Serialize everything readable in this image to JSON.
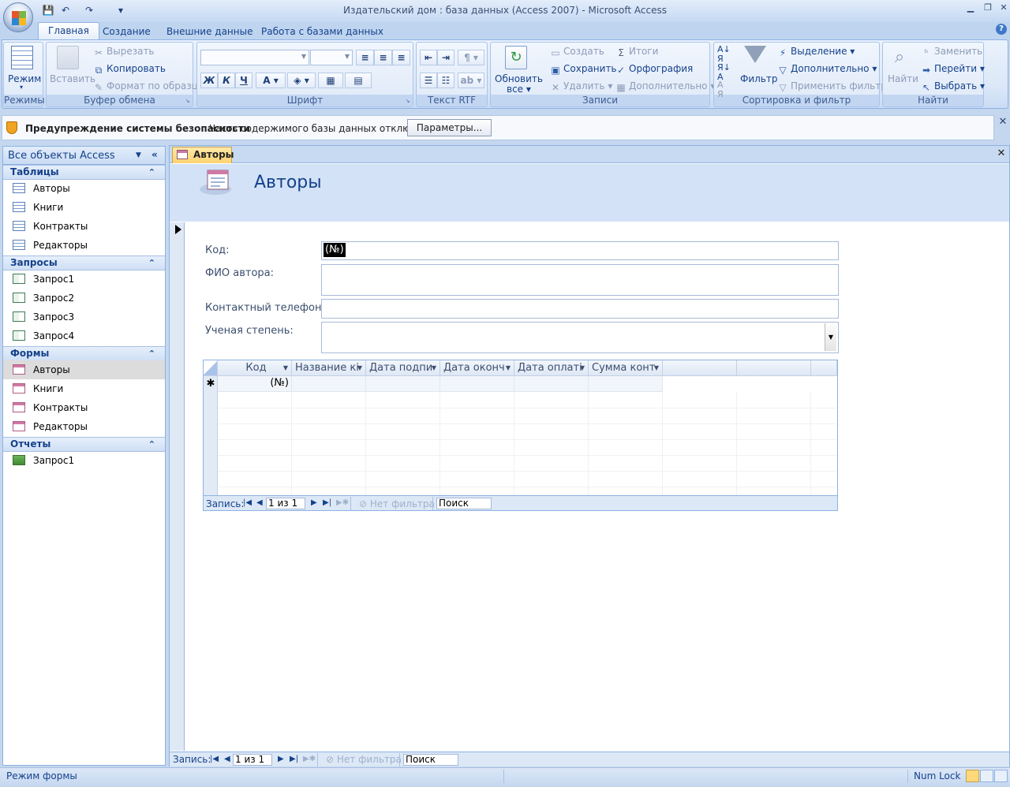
{
  "window": {
    "title": "Издательский дом : база данных (Access 2007) - Microsoft Access"
  },
  "qat": {
    "save": "💾",
    "undo": "↶",
    "redo": "↷",
    "customize": "▾"
  },
  "ribbon_tabs": [
    "Главная",
    "Создание",
    "Внешние данные",
    "Работа с базами данных"
  ],
  "ribbon": {
    "groups": {
      "views": "Режимы",
      "clipboard": "Буфер обмена",
      "font": "Шрифт",
      "rtf": "Текст RTF",
      "records": "Записи",
      "sortfilter": "Сортировка и фильтр",
      "find": "Найти"
    },
    "view_btn": "Режим",
    "paste_btn": "Вставить",
    "cut": "Вырезать",
    "copy": "Копировать",
    "format_painter": "Формат по образцу",
    "font_buttons": [
      "Ж",
      "К",
      "Ч"
    ],
    "refresh_line1": "Обновить",
    "refresh_line2": "все",
    "new": "Создать",
    "save": "Сохранить",
    "delete": "Удалить",
    "totals": "Итоги",
    "spelling": "Орфография",
    "more": "Дополнительно",
    "filter": "Фильтр",
    "selection": "Выделение",
    "advanced": "Дополнительно",
    "apply_filter": "Применить фильтр",
    "find": "Найти",
    "replace": "Заменить",
    "goto": "Перейти",
    "select": "Выбрать"
  },
  "security": {
    "title": "Предупреждение системы безопасности",
    "message": "Часть содержимого базы данных отключено",
    "button": "Параметры..."
  },
  "nav": {
    "header": "Все объекты Access",
    "sections": [
      {
        "name": "Таблицы",
        "type": "table",
        "items": [
          "Авторы",
          "Книги",
          "Контракты",
          "Редакторы"
        ]
      },
      {
        "name": "Запросы",
        "type": "query",
        "items": [
          "Запрос1",
          "Запрос2",
          "Запрос3",
          "Запрос4"
        ]
      },
      {
        "name": "Формы",
        "type": "form",
        "items": [
          "Авторы",
          "Книги",
          "Контракты",
          "Редакторы"
        ]
      },
      {
        "name": "Отчеты",
        "type": "report",
        "items": [
          "Запрос1"
        ]
      }
    ],
    "selected": "Авторы (форма)"
  },
  "document": {
    "tab": "Авторы",
    "form_title": "Авторы",
    "fields": {
      "code_label": "Код:",
      "code_value": "(№)",
      "fio_label": "ФИО автора:",
      "phone_label": "Контактный телефон:",
      "degree_label": "Ученая степень:"
    },
    "subform": {
      "columns": [
        "Код",
        "Название кі",
        "Дата подпи",
        "Дата оконч",
        "Дата оплаті",
        "Сумма конт"
      ],
      "new_row_marker": "✱",
      "new_row_code": "(№)",
      "nav": {
        "label": "Запись:",
        "position": "1 из 1",
        "filter": "Нет фильтра",
        "search": "Поиск"
      }
    },
    "nav": {
      "label": "Запись:",
      "position": "1 из 1",
      "filter": "Нет фильтра",
      "search": "Поиск"
    }
  },
  "status": {
    "left": "Режим формы",
    "numlock": "Num Lock"
  }
}
